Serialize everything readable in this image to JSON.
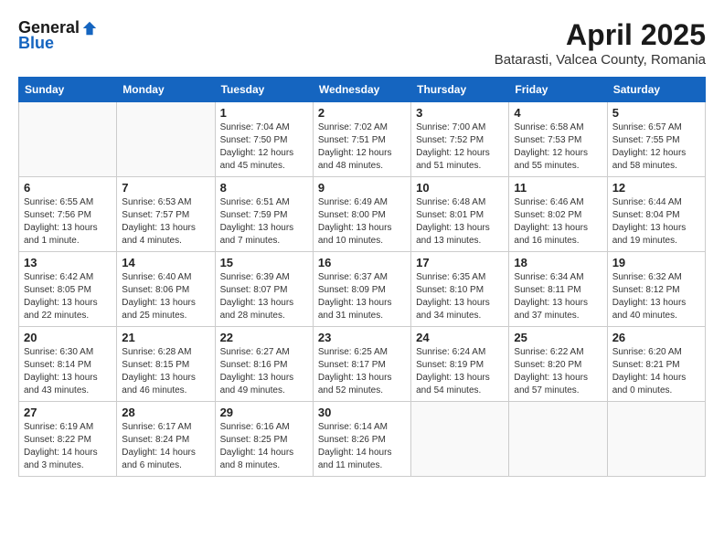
{
  "header": {
    "logo_general": "General",
    "logo_blue": "Blue",
    "month_title": "April 2025",
    "subtitle": "Batarasti, Valcea County, Romania"
  },
  "days_of_week": [
    "Sunday",
    "Monday",
    "Tuesday",
    "Wednesday",
    "Thursday",
    "Friday",
    "Saturday"
  ],
  "weeks": [
    [
      {
        "day": "",
        "info": ""
      },
      {
        "day": "",
        "info": ""
      },
      {
        "day": "1",
        "info": "Sunrise: 7:04 AM\nSunset: 7:50 PM\nDaylight: 12 hours\nand 45 minutes."
      },
      {
        "day": "2",
        "info": "Sunrise: 7:02 AM\nSunset: 7:51 PM\nDaylight: 12 hours\nand 48 minutes."
      },
      {
        "day": "3",
        "info": "Sunrise: 7:00 AM\nSunset: 7:52 PM\nDaylight: 12 hours\nand 51 minutes."
      },
      {
        "day": "4",
        "info": "Sunrise: 6:58 AM\nSunset: 7:53 PM\nDaylight: 12 hours\nand 55 minutes."
      },
      {
        "day": "5",
        "info": "Sunrise: 6:57 AM\nSunset: 7:55 PM\nDaylight: 12 hours\nand 58 minutes."
      }
    ],
    [
      {
        "day": "6",
        "info": "Sunrise: 6:55 AM\nSunset: 7:56 PM\nDaylight: 13 hours\nand 1 minute."
      },
      {
        "day": "7",
        "info": "Sunrise: 6:53 AM\nSunset: 7:57 PM\nDaylight: 13 hours\nand 4 minutes."
      },
      {
        "day": "8",
        "info": "Sunrise: 6:51 AM\nSunset: 7:59 PM\nDaylight: 13 hours\nand 7 minutes."
      },
      {
        "day": "9",
        "info": "Sunrise: 6:49 AM\nSunset: 8:00 PM\nDaylight: 13 hours\nand 10 minutes."
      },
      {
        "day": "10",
        "info": "Sunrise: 6:48 AM\nSunset: 8:01 PM\nDaylight: 13 hours\nand 13 minutes."
      },
      {
        "day": "11",
        "info": "Sunrise: 6:46 AM\nSunset: 8:02 PM\nDaylight: 13 hours\nand 16 minutes."
      },
      {
        "day": "12",
        "info": "Sunrise: 6:44 AM\nSunset: 8:04 PM\nDaylight: 13 hours\nand 19 minutes."
      }
    ],
    [
      {
        "day": "13",
        "info": "Sunrise: 6:42 AM\nSunset: 8:05 PM\nDaylight: 13 hours\nand 22 minutes."
      },
      {
        "day": "14",
        "info": "Sunrise: 6:40 AM\nSunset: 8:06 PM\nDaylight: 13 hours\nand 25 minutes."
      },
      {
        "day": "15",
        "info": "Sunrise: 6:39 AM\nSunset: 8:07 PM\nDaylight: 13 hours\nand 28 minutes."
      },
      {
        "day": "16",
        "info": "Sunrise: 6:37 AM\nSunset: 8:09 PM\nDaylight: 13 hours\nand 31 minutes."
      },
      {
        "day": "17",
        "info": "Sunrise: 6:35 AM\nSunset: 8:10 PM\nDaylight: 13 hours\nand 34 minutes."
      },
      {
        "day": "18",
        "info": "Sunrise: 6:34 AM\nSunset: 8:11 PM\nDaylight: 13 hours\nand 37 minutes."
      },
      {
        "day": "19",
        "info": "Sunrise: 6:32 AM\nSunset: 8:12 PM\nDaylight: 13 hours\nand 40 minutes."
      }
    ],
    [
      {
        "day": "20",
        "info": "Sunrise: 6:30 AM\nSunset: 8:14 PM\nDaylight: 13 hours\nand 43 minutes."
      },
      {
        "day": "21",
        "info": "Sunrise: 6:28 AM\nSunset: 8:15 PM\nDaylight: 13 hours\nand 46 minutes."
      },
      {
        "day": "22",
        "info": "Sunrise: 6:27 AM\nSunset: 8:16 PM\nDaylight: 13 hours\nand 49 minutes."
      },
      {
        "day": "23",
        "info": "Sunrise: 6:25 AM\nSunset: 8:17 PM\nDaylight: 13 hours\nand 52 minutes."
      },
      {
        "day": "24",
        "info": "Sunrise: 6:24 AM\nSunset: 8:19 PM\nDaylight: 13 hours\nand 54 minutes."
      },
      {
        "day": "25",
        "info": "Sunrise: 6:22 AM\nSunset: 8:20 PM\nDaylight: 13 hours\nand 57 minutes."
      },
      {
        "day": "26",
        "info": "Sunrise: 6:20 AM\nSunset: 8:21 PM\nDaylight: 14 hours\nand 0 minutes."
      }
    ],
    [
      {
        "day": "27",
        "info": "Sunrise: 6:19 AM\nSunset: 8:22 PM\nDaylight: 14 hours\nand 3 minutes."
      },
      {
        "day": "28",
        "info": "Sunrise: 6:17 AM\nSunset: 8:24 PM\nDaylight: 14 hours\nand 6 minutes."
      },
      {
        "day": "29",
        "info": "Sunrise: 6:16 AM\nSunset: 8:25 PM\nDaylight: 14 hours\nand 8 minutes."
      },
      {
        "day": "30",
        "info": "Sunrise: 6:14 AM\nSunset: 8:26 PM\nDaylight: 14 hours\nand 11 minutes."
      },
      {
        "day": "",
        "info": ""
      },
      {
        "day": "",
        "info": ""
      },
      {
        "day": "",
        "info": ""
      }
    ]
  ]
}
